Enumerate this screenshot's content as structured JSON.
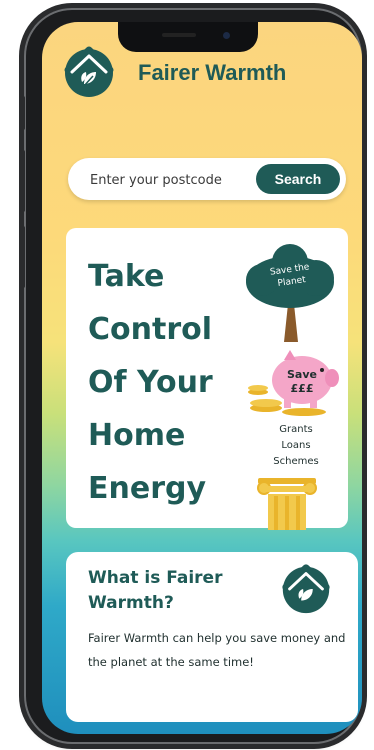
{
  "header": {
    "brand_name": "Fairer Warmth"
  },
  "search": {
    "placeholder": "Enter your postcode",
    "button_label": "Search"
  },
  "hero": {
    "title_lines": [
      "Take",
      "Control",
      "Of Your",
      "Home",
      "Energy"
    ],
    "tree_label_line1": "Save the",
    "tree_label_line2": "Planet",
    "pig_label_line1": "Save",
    "pig_label_line2": "£££",
    "grants_lines": [
      "Grants",
      "Loans",
      "Schemes"
    ]
  },
  "info": {
    "title": "What is Fairer Warmth?",
    "body": "Fairer Warmth can help you save money and the planet at the same time!"
  },
  "colors": {
    "brand_teal": "#1f5b57",
    "background_top": "#fbd57f",
    "background_bottom": "#1f8fbd",
    "pig_pink": "#f4a6c8",
    "coin_gold": "#e9b42b"
  },
  "icons": {
    "logo": "house-with-leaf-icon",
    "tree": "tree-icon",
    "piggy_bank": "piggy-bank-icon",
    "pillar": "pillar-icon"
  }
}
